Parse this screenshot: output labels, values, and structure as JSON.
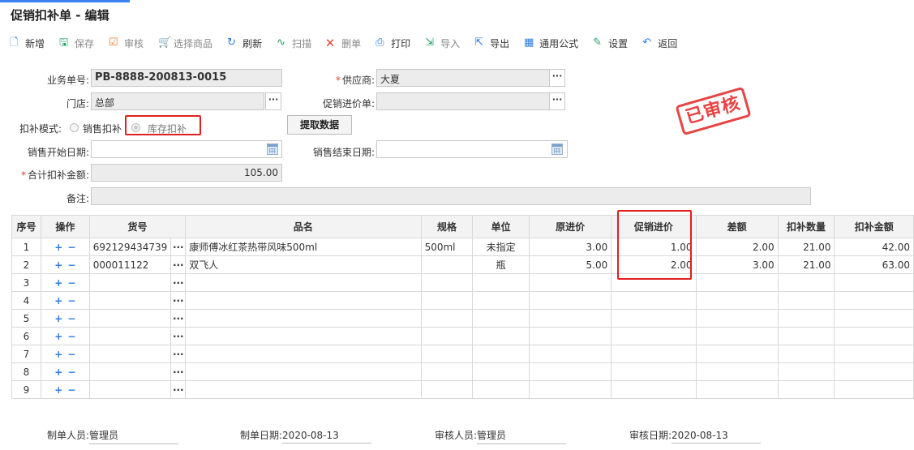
{
  "title": "促销扣补单 - 编辑",
  "toolbar": [
    {
      "label": "新增",
      "icon": "new-doc-icon",
      "color": "#2a7de1",
      "disabled": false
    },
    {
      "label": "保存",
      "icon": "save-icon",
      "color": "#21a366",
      "disabled": true
    },
    {
      "label": "审核",
      "icon": "approve-icon",
      "color": "#e87a1e",
      "disabled": true
    },
    {
      "label": "选择商品",
      "icon": "cart-icon",
      "color": "#2a7de1",
      "disabled": true
    },
    {
      "label": "刷新",
      "icon": "refresh-icon",
      "color": "#2a7de1",
      "disabled": false
    },
    {
      "label": "扫描",
      "icon": "scan-icon",
      "color": "#21a366",
      "disabled": true
    },
    {
      "label": "删单",
      "icon": "delete-doc-icon",
      "color": "#e14b3b",
      "disabled": true
    },
    {
      "label": "打印",
      "icon": "print-icon",
      "color": "#2a7de1",
      "disabled": false
    },
    {
      "label": "导入",
      "icon": "import-icon",
      "color": "#21a366",
      "disabled": true
    },
    {
      "label": "导出",
      "icon": "export-icon",
      "color": "#2a7de1",
      "disabled": false
    },
    {
      "label": "通用公式",
      "icon": "formula-icon",
      "color": "#2a7de1",
      "disabled": false
    },
    {
      "label": "设置",
      "icon": "settings-icon",
      "color": "#21a366",
      "disabled": false
    },
    {
      "label": "返回",
      "icon": "back-icon",
      "color": "#2a7de1",
      "disabled": false
    }
  ],
  "form": {
    "doc_no_label": "业务单号:",
    "doc_no": "PB-8888-200813-0015",
    "supplier_label": "供应商:",
    "supplier": "大夏",
    "store_label": "门店:",
    "store": "总部",
    "promo_price_label": "促销进价单:",
    "promo_price": "",
    "mode_label": "扣补模式:",
    "mode_sales": "销售扣补",
    "mode_stock": "库存扣补",
    "fetch_button": "提取数据",
    "start_date_label": "销售开始日期:",
    "start_date": "",
    "end_date_label": "销售结束日期:",
    "end_date": "",
    "total_label": "合计扣补金额:",
    "total": "105.00",
    "remark_label": "备注:",
    "remark": ""
  },
  "stamp": "已审核",
  "table": {
    "headers": [
      "序号",
      "操作",
      "货号",
      "品名",
      "规格",
      "单位",
      "原进价",
      "促销进价",
      "差额",
      "扣补数量",
      "扣补金额"
    ],
    "rows": [
      {
        "no": "1",
        "sku": "692129434739",
        "name": "康师傅冰红茶热带风味500ml",
        "spec": "500ml",
        "unit": "未指定",
        "orig": "3.00",
        "promo": "1.00",
        "diff": "2.00",
        "qty": "21.00",
        "amt": "42.00"
      },
      {
        "no": "2",
        "sku": "000011122",
        "name": "双飞人",
        "spec": "",
        "unit": "瓶",
        "orig": "5.00",
        "promo": "2.00",
        "diff": "3.00",
        "qty": "21.00",
        "amt": "63.00"
      },
      {
        "no": "3",
        "sku": "",
        "name": "",
        "spec": "",
        "unit": "",
        "orig": "",
        "promo": "",
        "diff": "",
        "qty": "",
        "amt": ""
      },
      {
        "no": "4",
        "sku": "",
        "name": "",
        "spec": "",
        "unit": "",
        "orig": "",
        "promo": "",
        "diff": "",
        "qty": "",
        "amt": ""
      },
      {
        "no": "5",
        "sku": "",
        "name": "",
        "spec": "",
        "unit": "",
        "orig": "",
        "promo": "",
        "diff": "",
        "qty": "",
        "amt": ""
      },
      {
        "no": "6",
        "sku": "",
        "name": "",
        "spec": "",
        "unit": "",
        "orig": "",
        "promo": "",
        "diff": "",
        "qty": "",
        "amt": ""
      },
      {
        "no": "7",
        "sku": "",
        "name": "",
        "spec": "",
        "unit": "",
        "orig": "",
        "promo": "",
        "diff": "",
        "qty": "",
        "amt": ""
      },
      {
        "no": "8",
        "sku": "",
        "name": "",
        "spec": "",
        "unit": "",
        "orig": "",
        "promo": "",
        "diff": "",
        "qty": "",
        "amt": ""
      },
      {
        "no": "9",
        "sku": "",
        "name": "",
        "spec": "",
        "unit": "",
        "orig": "",
        "promo": "",
        "diff": "",
        "qty": "",
        "amt": ""
      }
    ],
    "op_add": "+",
    "op_remove": "−",
    "ellipsis": "···"
  },
  "footer": {
    "creator_label": "制单人员:",
    "creator": "管理员",
    "create_date_label": "制单日期:",
    "create_date": "2020-08-13",
    "auditor_label": "审核人员:",
    "auditor": "管理员",
    "audit_date_label": "审核日期:",
    "audit_date": "2020-08-13"
  }
}
